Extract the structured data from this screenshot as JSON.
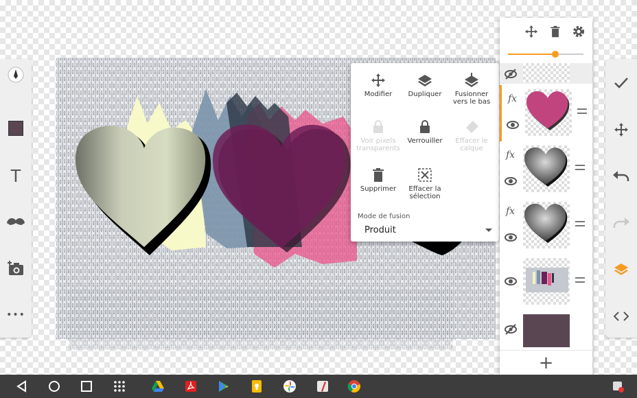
{
  "left_toolbar": {
    "items": [
      {
        "icon": "brush-icon"
      },
      {
        "icon": "color-swatch-icon",
        "color": "#5a4652"
      },
      {
        "icon": "text-icon",
        "label": "T"
      },
      {
        "icon": "mustache-sticker-icon"
      },
      {
        "icon": "add-photo-icon"
      },
      {
        "icon": "more-icon",
        "label": "•••"
      }
    ]
  },
  "layers_panel": {
    "opacity_slider": {
      "value": 0.63,
      "accent": "#f59b21"
    },
    "layers": [
      {
        "name": "hidden-top",
        "fx": false,
        "visible": false
      },
      {
        "name": "pink-heart",
        "fx": true,
        "fx_label": "fx",
        "visible": true,
        "selected": true
      },
      {
        "name": "gray-heart-1",
        "fx": true,
        "fx_label": "fx",
        "visible": true
      },
      {
        "name": "gray-heart-2",
        "fx": true,
        "fx_label": "fx",
        "visible": true
      },
      {
        "name": "background-art",
        "fx": false,
        "visible": true
      },
      {
        "name": "color-fill",
        "fx": false,
        "visible": false,
        "color": "#5a4652"
      }
    ],
    "add_label": "+"
  },
  "context_menu": {
    "items": [
      {
        "label": "Modifier",
        "enabled": true,
        "icon": "move-icon"
      },
      {
        "label": "Dupliquer",
        "enabled": true,
        "icon": "duplicate-layers-icon"
      },
      {
        "label": "Fusionner vers le bas",
        "enabled": true,
        "icon": "merge-down-icon"
      },
      {
        "label": "Voir pixels transparents",
        "enabled": false,
        "icon": "transparency-lock-icon"
      },
      {
        "label": "Verrouiller",
        "enabled": true,
        "icon": "lock-icon"
      },
      {
        "label": "Effacer le calque",
        "enabled": false,
        "icon": "eraser-icon"
      },
      {
        "label": "Supprimer",
        "enabled": true,
        "icon": "trash-icon"
      },
      {
        "label": "Effacer la sélection",
        "enabled": true,
        "icon": "clear-selection-icon"
      }
    ],
    "blend_mode_label": "Mode de fusion",
    "blend_mode_value": "Produit"
  },
  "right_toolbar": {
    "items": [
      {
        "icon": "check-icon"
      },
      {
        "icon": "transform-icon"
      },
      {
        "icon": "undo-icon"
      },
      {
        "icon": "redo-icon",
        "enabled": false
      },
      {
        "icon": "layers-icon",
        "active": true
      },
      {
        "icon": "code-toggle-icon"
      }
    ],
    "accent": "#f59b21"
  },
  "navbar": {
    "items": [
      "back-icon",
      "home-icon",
      "recents-icon",
      "apps-grid-icon",
      "drive-icon",
      "acrobat-icon",
      "play-store-icon",
      "keep-icon",
      "photos-icon",
      "sketchbook-icon",
      "chrome-icon",
      "notification-icon"
    ]
  }
}
